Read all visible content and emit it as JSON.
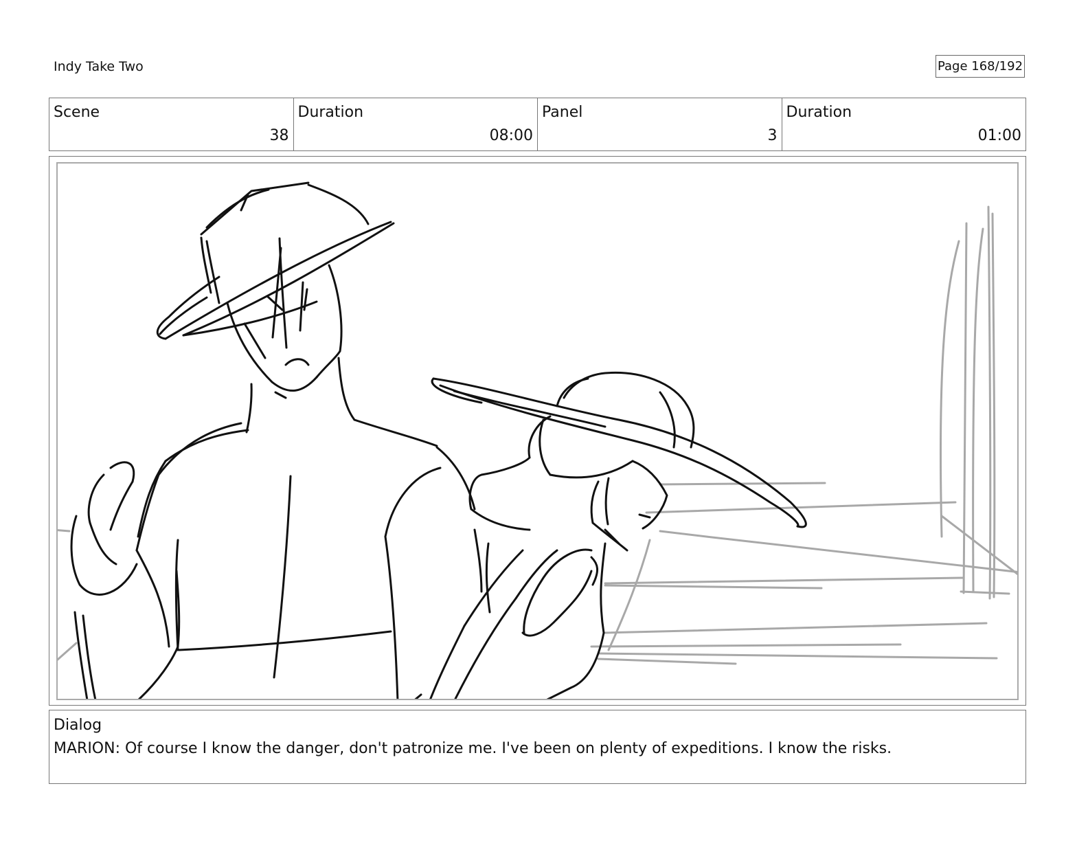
{
  "header": {
    "project_title": "Indy Take Two",
    "page_label": "Page 168/192"
  },
  "info": {
    "scene_label": "Scene",
    "scene_value": "38",
    "scene_duration_label": "Duration",
    "scene_duration_value": "08:00",
    "panel_label": "Panel",
    "panel_value": "3",
    "panel_duration_label": "Duration",
    "panel_duration_value": "01:00"
  },
  "dialog": {
    "label": "Dialog",
    "text": "MARION: Of course I know the danger, don't patronize me. I've been on plenty of expeditions. I know the risks."
  },
  "colors": {
    "sketch_ink": "#111111",
    "background_sketch": "#a8a8a8"
  }
}
